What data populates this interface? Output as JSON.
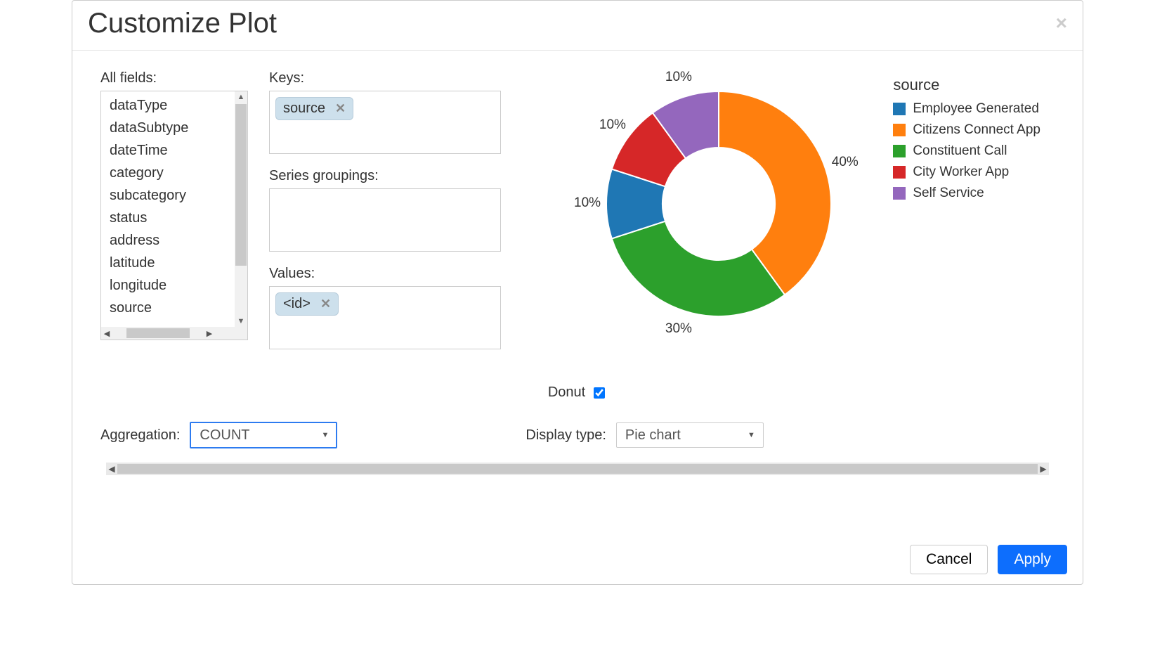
{
  "dialog": {
    "title": "Customize Plot",
    "close_icon": "×"
  },
  "fields_panel": {
    "label": "All fields:",
    "items": [
      "dataType",
      "dataSubtype",
      "dateTime",
      "category",
      "subcategory",
      "status",
      "address",
      "latitude",
      "longitude",
      "source"
    ]
  },
  "keys_panel": {
    "label": "Keys:",
    "chips": [
      "source"
    ]
  },
  "series_panel": {
    "label": "Series groupings:",
    "chips": []
  },
  "values_panel": {
    "label": "Values:",
    "chips": [
      "<id>"
    ]
  },
  "donut": {
    "label": "Donut",
    "checked": true
  },
  "aggregation": {
    "label": "Aggregation:",
    "value": "COUNT"
  },
  "display_type": {
    "label": "Display type:",
    "value": "Pie chart"
  },
  "footer": {
    "cancel": "Cancel",
    "apply": "Apply"
  },
  "chart_data": {
    "type": "pie",
    "donut": true,
    "title": "source",
    "legend_position": "right",
    "categories": [
      "Employee Generated",
      "Citizens Connect App",
      "Constituent Call",
      "City Worker App",
      "Self Service"
    ],
    "values_pct": [
      10,
      40,
      30,
      10,
      10
    ],
    "data_labels": [
      "10%",
      "40%",
      "30%",
      "10%",
      "10%"
    ],
    "colors": [
      "#1f77b4",
      "#ff7f0e",
      "#2ca02c",
      "#d62728",
      "#9467bd"
    ]
  }
}
